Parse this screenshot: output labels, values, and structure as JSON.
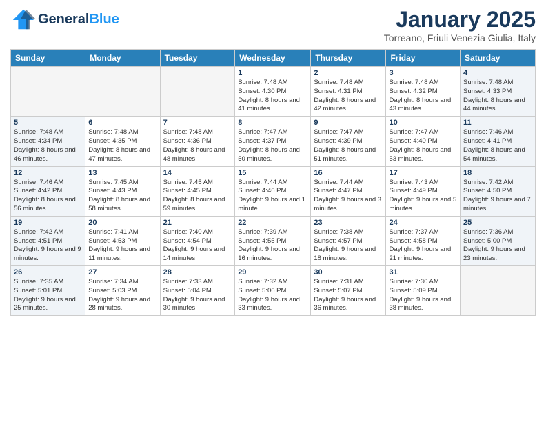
{
  "header": {
    "logo_general": "General",
    "logo_blue": "Blue",
    "month": "January 2025",
    "location": "Torreano, Friuli Venezia Giulia, Italy"
  },
  "days_of_week": [
    "Sunday",
    "Monday",
    "Tuesday",
    "Wednesday",
    "Thursday",
    "Friday",
    "Saturday"
  ],
  "weeks": [
    {
      "days": [
        {
          "num": "",
          "empty": true
        },
        {
          "num": "",
          "empty": true
        },
        {
          "num": "",
          "empty": true
        },
        {
          "num": "1",
          "sunrise": "7:48 AM",
          "sunset": "4:30 PM",
          "daylight": "8 hours and 41 minutes."
        },
        {
          "num": "2",
          "sunrise": "7:48 AM",
          "sunset": "4:31 PM",
          "daylight": "8 hours and 42 minutes."
        },
        {
          "num": "3",
          "sunrise": "7:48 AM",
          "sunset": "4:32 PM",
          "daylight": "8 hours and 43 minutes."
        },
        {
          "num": "4",
          "sunrise": "7:48 AM",
          "sunset": "4:33 PM",
          "daylight": "8 hours and 44 minutes.",
          "weekend": true
        }
      ]
    },
    {
      "days": [
        {
          "num": "5",
          "sunrise": "7:48 AM",
          "sunset": "4:34 PM",
          "daylight": "8 hours and 46 minutes.",
          "weekend": true
        },
        {
          "num": "6",
          "sunrise": "7:48 AM",
          "sunset": "4:35 PM",
          "daylight": "8 hours and 47 minutes."
        },
        {
          "num": "7",
          "sunrise": "7:48 AM",
          "sunset": "4:36 PM",
          "daylight": "8 hours and 48 minutes."
        },
        {
          "num": "8",
          "sunrise": "7:47 AM",
          "sunset": "4:37 PM",
          "daylight": "8 hours and 50 minutes."
        },
        {
          "num": "9",
          "sunrise": "7:47 AM",
          "sunset": "4:39 PM",
          "daylight": "8 hours and 51 minutes."
        },
        {
          "num": "10",
          "sunrise": "7:47 AM",
          "sunset": "4:40 PM",
          "daylight": "8 hours and 53 minutes."
        },
        {
          "num": "11",
          "sunrise": "7:46 AM",
          "sunset": "4:41 PM",
          "daylight": "8 hours and 54 minutes.",
          "weekend": true
        }
      ]
    },
    {
      "days": [
        {
          "num": "12",
          "sunrise": "7:46 AM",
          "sunset": "4:42 PM",
          "daylight": "8 hours and 56 minutes.",
          "weekend": true
        },
        {
          "num": "13",
          "sunrise": "7:45 AM",
          "sunset": "4:43 PM",
          "daylight": "8 hours and 58 minutes."
        },
        {
          "num": "14",
          "sunrise": "7:45 AM",
          "sunset": "4:45 PM",
          "daylight": "8 hours and 59 minutes."
        },
        {
          "num": "15",
          "sunrise": "7:44 AM",
          "sunset": "4:46 PM",
          "daylight": "9 hours and 1 minute."
        },
        {
          "num": "16",
          "sunrise": "7:44 AM",
          "sunset": "4:47 PM",
          "daylight": "9 hours and 3 minutes."
        },
        {
          "num": "17",
          "sunrise": "7:43 AM",
          "sunset": "4:49 PM",
          "daylight": "9 hours and 5 minutes."
        },
        {
          "num": "18",
          "sunrise": "7:42 AM",
          "sunset": "4:50 PM",
          "daylight": "9 hours and 7 minutes.",
          "weekend": true
        }
      ]
    },
    {
      "days": [
        {
          "num": "19",
          "sunrise": "7:42 AM",
          "sunset": "4:51 PM",
          "daylight": "9 hours and 9 minutes.",
          "weekend": true
        },
        {
          "num": "20",
          "sunrise": "7:41 AM",
          "sunset": "4:53 PM",
          "daylight": "9 hours and 11 minutes."
        },
        {
          "num": "21",
          "sunrise": "7:40 AM",
          "sunset": "4:54 PM",
          "daylight": "9 hours and 14 minutes."
        },
        {
          "num": "22",
          "sunrise": "7:39 AM",
          "sunset": "4:55 PM",
          "daylight": "9 hours and 16 minutes."
        },
        {
          "num": "23",
          "sunrise": "7:38 AM",
          "sunset": "4:57 PM",
          "daylight": "9 hours and 18 minutes."
        },
        {
          "num": "24",
          "sunrise": "7:37 AM",
          "sunset": "4:58 PM",
          "daylight": "9 hours and 21 minutes."
        },
        {
          "num": "25",
          "sunrise": "7:36 AM",
          "sunset": "5:00 PM",
          "daylight": "9 hours and 23 minutes.",
          "weekend": true
        }
      ]
    },
    {
      "days": [
        {
          "num": "26",
          "sunrise": "7:35 AM",
          "sunset": "5:01 PM",
          "daylight": "9 hours and 25 minutes.",
          "weekend": true
        },
        {
          "num": "27",
          "sunrise": "7:34 AM",
          "sunset": "5:03 PM",
          "daylight": "9 hours and 28 minutes."
        },
        {
          "num": "28",
          "sunrise": "7:33 AM",
          "sunset": "5:04 PM",
          "daylight": "9 hours and 30 minutes."
        },
        {
          "num": "29",
          "sunrise": "7:32 AM",
          "sunset": "5:06 PM",
          "daylight": "9 hours and 33 minutes."
        },
        {
          "num": "30",
          "sunrise": "7:31 AM",
          "sunset": "5:07 PM",
          "daylight": "9 hours and 36 minutes."
        },
        {
          "num": "31",
          "sunrise": "7:30 AM",
          "sunset": "5:09 PM",
          "daylight": "9 hours and 38 minutes."
        },
        {
          "num": "",
          "empty": true
        }
      ]
    }
  ]
}
